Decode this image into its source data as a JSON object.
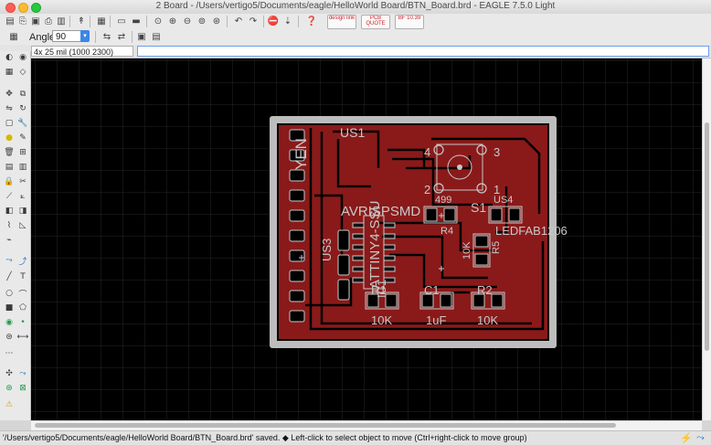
{
  "window": {
    "title": "2 Board - /Users/vertigo5/Documents/eagle/HelloWorld Board/BTN_Board.brd - EAGLE 7.5.0 Light"
  },
  "toolbar": {
    "promo_buttons": [
      {
        "label": "design link"
      },
      {
        "label": "PCB QUOTE"
      },
      {
        "label": "BF 10.39"
      }
    ]
  },
  "params": {
    "angle_label": "Angle:",
    "angle_value": "90"
  },
  "command": {
    "coordinate_display": "4x 25 mil (1000 2300)",
    "input_value": ""
  },
  "board": {
    "labels": {
      "yen": "YEN",
      "us1": "US1",
      "avrisp": "AVRISPSMD",
      "attiny": "ATTINY4-SSU",
      "us3": "US3",
      "ic1": "IC1",
      "r1": "R1",
      "c1": "C1",
      "r2": "R2",
      "r1_val": "10K",
      "c1_val": "1uF",
      "r2_val": "10K",
      "s1": "S1",
      "us4": "US4",
      "r4_val": "499",
      "r4": "R4",
      "r5_val": "10K",
      "r5": "R5",
      "led": "LEDFAB1206",
      "pin1": "1",
      "pin2": "2",
      "pin3": "3",
      "pin4": "4"
    }
  },
  "status": {
    "message": "'/Users/vertigo5/Documents/eagle/HelloWorld Board/BTN_Board.brd' saved.  ◆ Left-click to select object to move (Ctrl+right-click to move group)"
  },
  "colors": {
    "canvas": "#000000",
    "copper": "#8a1a1a",
    "grid": "#2a2a2a",
    "outline": "#c8c8c8"
  }
}
